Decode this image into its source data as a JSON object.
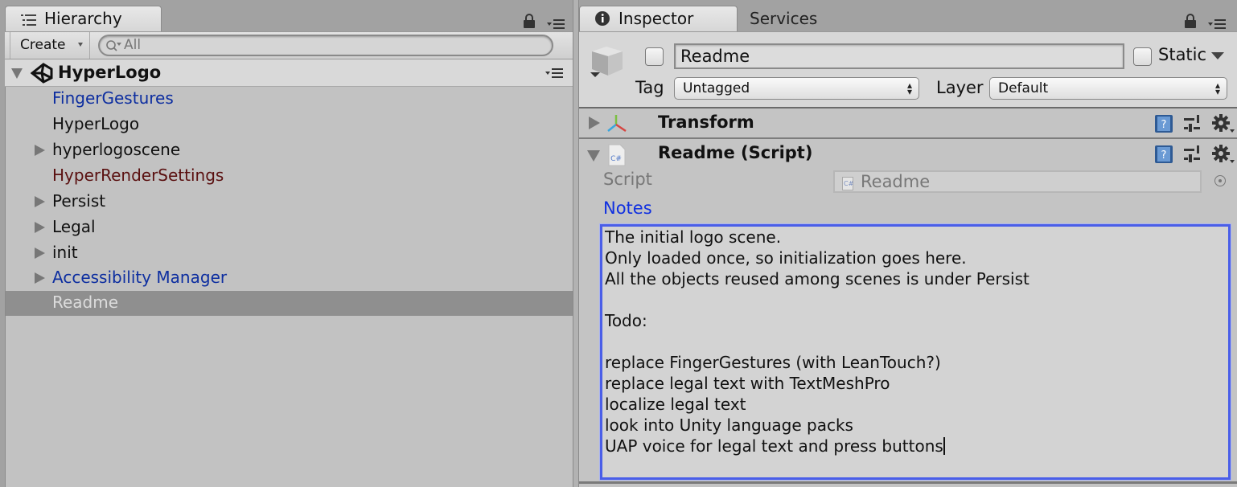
{
  "hierarchy": {
    "tab_label": "Hierarchy",
    "create_label": "Create",
    "search_placeholder": "All",
    "scene": {
      "name": "HyperLogo",
      "expanded": true
    },
    "items": [
      {
        "label": "FingerGestures",
        "color": "#0d2ea0",
        "has_children": false,
        "selected": false
      },
      {
        "label": "HyperLogo",
        "color": "#111111",
        "has_children": false,
        "selected": false
      },
      {
        "label": "hyperlogoscene",
        "color": "#111111",
        "has_children": true,
        "selected": false
      },
      {
        "label": "HyperRenderSettings",
        "color": "#5a1010",
        "has_children": false,
        "selected": false
      },
      {
        "label": "Persist",
        "color": "#111111",
        "has_children": true,
        "selected": false
      },
      {
        "label": "Legal",
        "color": "#111111",
        "has_children": true,
        "selected": false
      },
      {
        "label": "init",
        "color": "#111111",
        "has_children": true,
        "selected": false
      },
      {
        "label": "Accessibility Manager",
        "color": "#0d2ea0",
        "has_children": true,
        "selected": false
      },
      {
        "label": "Readme",
        "color": "#dcdcdc",
        "has_children": false,
        "selected": true
      }
    ]
  },
  "inspector": {
    "tabs": [
      {
        "label": "Inspector",
        "active": true,
        "icon": "info-icon"
      },
      {
        "label": "Services",
        "active": false
      }
    ],
    "object_name": "Readme",
    "active_checked": false,
    "static_label": "Static",
    "static_checked": false,
    "tag_label": "Tag",
    "tag_value": "Untagged",
    "layer_label": "Layer",
    "layer_value": "Default",
    "components": [
      {
        "title": "Transform",
        "expanded": false,
        "icon": "transform-axes-icon"
      },
      {
        "title": "Readme (Script)",
        "expanded": true,
        "icon": "csharp-script-icon"
      }
    ],
    "script_label": "Script",
    "script_value": "Readme",
    "notes_label": "Notes",
    "notes_text": "The initial logo scene.\nOnly loaded once, so initialization goes here.\nAll the objects reused among scenes is under Persist\n\nTodo:\n\nreplace FingerGestures (with LeanTouch?)\nreplace legal text with TextMeshPro\nlocalize legal text\nlook into Unity language packs\nUAP voice for legal text and press buttons",
    "accent_color": "#4a5ee8",
    "notes_label_color": "#1030e0"
  }
}
